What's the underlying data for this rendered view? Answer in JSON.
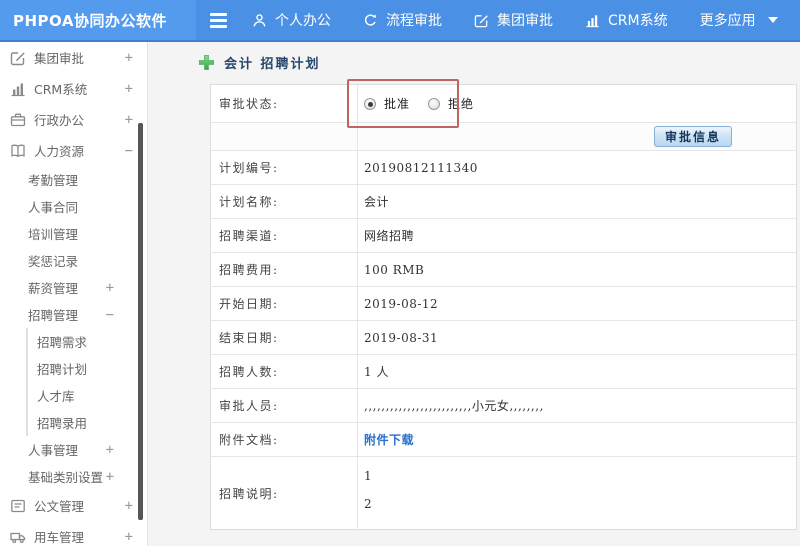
{
  "topbar": {
    "logo": "PHPOA协同办公软件",
    "menu": [
      {
        "label": "个人办公",
        "icon": "person-icon",
        "name": "nav-personal-office"
      },
      {
        "label": "流程审批",
        "icon": "process-icon",
        "name": "nav-workflow-approval"
      },
      {
        "label": "集团审批",
        "icon": "edit-square-icon",
        "name": "nav-group-approval"
      },
      {
        "label": "CRM系统",
        "icon": "bar-chart-icon",
        "name": "nav-crm-system"
      },
      {
        "label": "更多应用",
        "icon": "caret-down-icon",
        "name": "nav-more-apps"
      }
    ]
  },
  "sidebar": {
    "items": [
      {
        "label": "集团审批",
        "level": 1,
        "icon": "edit-square-icon",
        "expand": "+",
        "name": "sidebar-item-group-approval"
      },
      {
        "label": "CRM系统",
        "level": 1,
        "icon": "bar-chart-icon",
        "expand": "+",
        "name": "sidebar-item-crm-system"
      },
      {
        "label": "行政办公",
        "level": 1,
        "icon": "briefcase-icon",
        "expand": "+",
        "name": "sidebar-item-admin-office"
      },
      {
        "label": "人力资源",
        "level": 1,
        "icon": "book-icon",
        "expand": "−",
        "name": "sidebar-item-human-resources"
      },
      {
        "label": "考勤管理",
        "level": 2,
        "name": "sidebar-item-attendance"
      },
      {
        "label": "人事合同",
        "level": 2,
        "name": "sidebar-item-hr-contract"
      },
      {
        "label": "培训管理",
        "level": 2,
        "name": "sidebar-item-training"
      },
      {
        "label": "奖惩记录",
        "level": 2,
        "name": "sidebar-item-reward-punishment"
      },
      {
        "label": "薪资管理",
        "level": 2,
        "expand": "+",
        "name": "sidebar-item-salary"
      },
      {
        "label": "招聘管理",
        "level": 2,
        "expand": "−",
        "name": "sidebar-item-recruit-mgmt"
      },
      {
        "label": "招聘需求",
        "level": 3,
        "name": "sidebar-item-recruit-demand"
      },
      {
        "label": "招聘计划",
        "level": 3,
        "name": "sidebar-item-recruit-plan"
      },
      {
        "label": "人才库",
        "level": 3,
        "name": "sidebar-item-talent-pool"
      },
      {
        "label": "招聘录用",
        "level": 3,
        "name": "sidebar-item-recruit-hire"
      },
      {
        "label": "人事管理",
        "level": 2,
        "expand": "+",
        "name": "sidebar-item-personnel-mgmt"
      },
      {
        "label": "基础类别设置",
        "level": 2,
        "expand": "+",
        "name": "sidebar-item-base-category"
      },
      {
        "label": "公文管理",
        "level": 1,
        "icon": "document-icon",
        "expand": "+",
        "name": "sidebar-item-document-mgmt"
      },
      {
        "label": "用车管理",
        "level": 1,
        "icon": "truck-icon",
        "expand": "+",
        "name": "sidebar-item-vehicle-mgmt"
      }
    ]
  },
  "page": {
    "title": "会计 招聘计划"
  },
  "form": {
    "status_label": "审批状态:",
    "radio_approve": "批准",
    "radio_reject": "拒绝",
    "approve_selected": true,
    "button": "审批信息",
    "rows": [
      {
        "label": "计划编号:",
        "value": "20190812111340",
        "name": "row-plan-number"
      },
      {
        "label": "计划名称:",
        "value": "会计",
        "name": "row-plan-name"
      },
      {
        "label": "招聘渠道:",
        "value": "网络招聘",
        "name": "row-recruit-channel"
      },
      {
        "label": "招聘费用:",
        "value": "100 RMB",
        "name": "row-recruit-fee"
      },
      {
        "label": "开始日期:",
        "value": "2019-08-12",
        "name": "row-start-date"
      },
      {
        "label": "结束日期:",
        "value": "2019-08-31",
        "name": "row-end-date"
      },
      {
        "label": "招聘人数:",
        "value": "1 人",
        "name": "row-headcount"
      },
      {
        "label": "审批人员:",
        "value": ",,,,,,,,,,,,,,,,,,,,,,,,,小元女,,,,,,,,",
        "name": "row-approvers"
      },
      {
        "label": "附件文档:",
        "value": "附件下载",
        "type": "link",
        "name": "row-attachment"
      },
      {
        "label": "招聘说明:",
        "value": [
          "1",
          "2"
        ],
        "type": "multiline",
        "name": "row-description"
      }
    ]
  },
  "colors": {
    "topbar_blue": "#4a90e4",
    "logo_blue": "#549bee",
    "accent_green": "#3cb454",
    "highlight_red": "#c06361",
    "link_blue": "#2c70cc",
    "title_navy": "#26466b",
    "button_face": "#cfe4f7",
    "button_border": "#86aed6"
  }
}
